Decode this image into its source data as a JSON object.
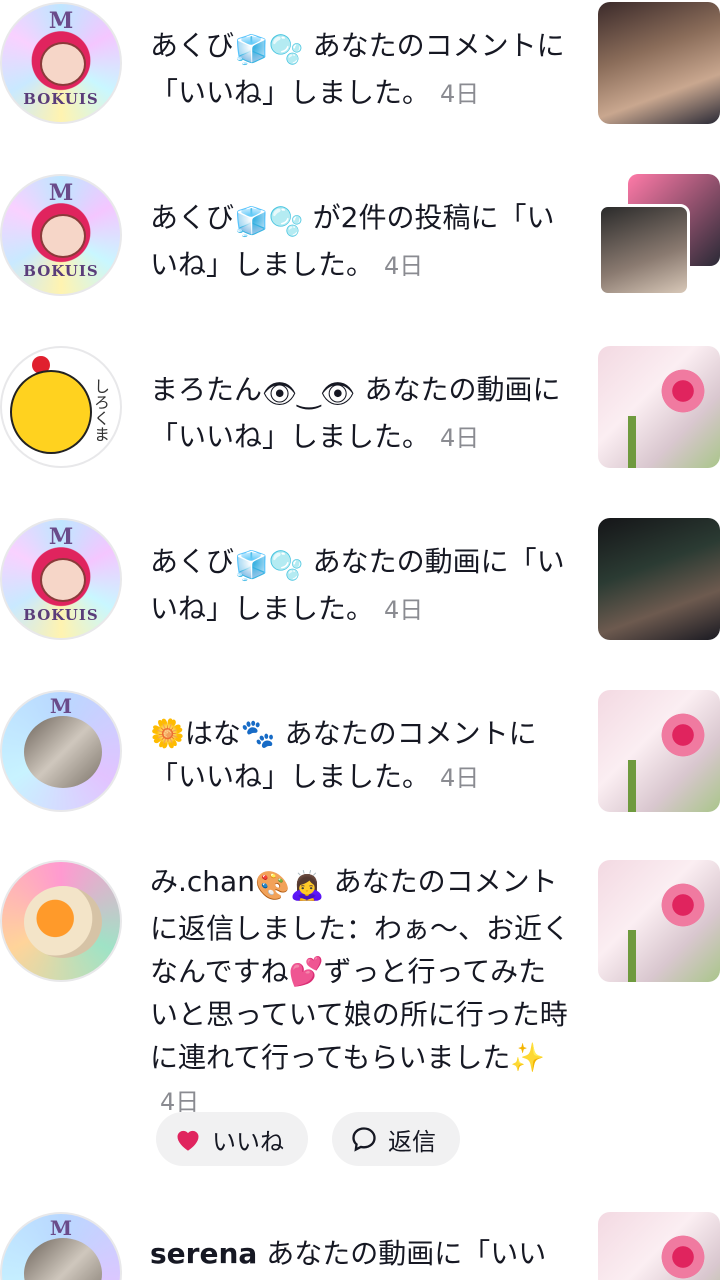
{
  "notifications": [
    {
      "name": "あくび",
      "emoji": "🧊🫧",
      "message": "あなたのコメントに「いいね」しました。",
      "time": "4日"
    },
    {
      "name": "あくび",
      "emoji": "🧊🫧",
      "message": "が2件の投稿に「いいね」しました。",
      "time": "4日"
    },
    {
      "name": "まろたん",
      "emoji": "👁‿👁",
      "message": "あなたの動画に「いいね」しました。",
      "time": "4日",
      "avatar_text": "しろくま"
    },
    {
      "name": "あくび",
      "emoji": "🧊🫧",
      "message": "あなたの動画に「いいね」しました。",
      "time": "4日"
    },
    {
      "name": "🌼はな🐾",
      "emoji": "",
      "message": "あなたのコメントに「いいね」しました。",
      "time": "4日"
    },
    {
      "name": "み.chan",
      "emoji": "🎨🙇‍♀️",
      "message": "あなたのコメントに返信しました：わぁ〜、お近くなんですね💕ずっと行ってみたいと思っていて娘の所に行った時に連れて行ってもらいました✨",
      "time": "4日"
    },
    {
      "name": "serena",
      "emoji": "",
      "message": "あなたの動画に「いい",
      "time": ""
    }
  ],
  "avatar_labels": {
    "monogram": "M",
    "ring_text": "BOKUIS"
  },
  "actions": {
    "like_label": "いいね",
    "reply_label": "返信"
  },
  "colors": {
    "like_heart": "#e0245e",
    "time_gray": "#8a8b91",
    "pill_bg": "#f1f1f2"
  }
}
